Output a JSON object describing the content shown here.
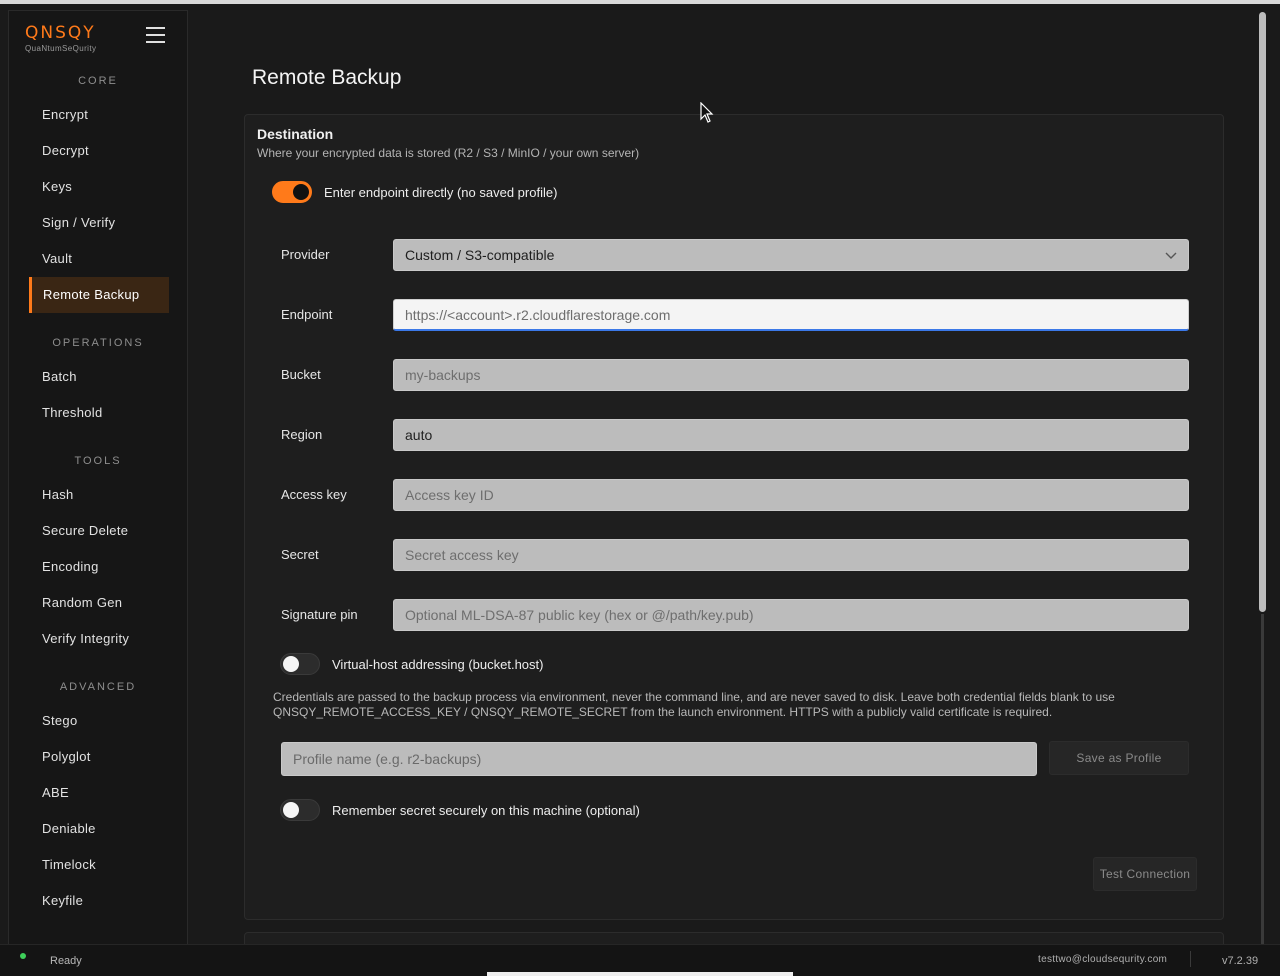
{
  "brand": {
    "logo": "QNSQY",
    "tagline": "QuaNtumSeQurity"
  },
  "sidebar": {
    "sections": [
      {
        "title": "CORE",
        "items": [
          "Encrypt",
          "Decrypt",
          "Keys",
          "Sign / Verify",
          "Vault",
          "Remote Backup"
        ]
      },
      {
        "title": "OPERATIONS",
        "items": [
          "Batch",
          "Threshold"
        ]
      },
      {
        "title": "TOOLS",
        "items": [
          "Hash",
          "Secure Delete",
          "Encoding",
          "Random Gen",
          "Verify Integrity"
        ]
      },
      {
        "title": "ADVANCED",
        "items": [
          "Stego",
          "Polyglot",
          "ABE",
          "Deniable",
          "Timelock",
          "Keyfile"
        ]
      }
    ],
    "active_item": "Remote Backup"
  },
  "page": {
    "title": "Remote Backup"
  },
  "destination": {
    "title": "Destination",
    "subtitle": "Where your encrypted data is stored (R2 / S3 / MinIO / your own server)",
    "direct_toggle": {
      "label": "Enter endpoint directly (no saved profile)",
      "on": true
    },
    "provider": {
      "label": "Provider",
      "value": "Custom / S3-compatible"
    },
    "endpoint": {
      "label": "Endpoint",
      "value": "",
      "placeholder": "https://<account>.r2.cloudflarestorage.com"
    },
    "bucket": {
      "label": "Bucket",
      "value": "",
      "placeholder": "my-backups"
    },
    "region": {
      "label": "Region",
      "value": "auto",
      "placeholder": ""
    },
    "access_key": {
      "label": "Access key",
      "value": "",
      "placeholder": "Access key ID"
    },
    "secret": {
      "label": "Secret",
      "value": "",
      "placeholder": "Secret access key"
    },
    "signature_pin": {
      "label": "Signature pin",
      "value": "",
      "placeholder": "Optional ML-DSA-87 public key (hex or @/path/key.pub)"
    },
    "virtual_host_toggle": {
      "label": "Virtual-host addressing (bucket.host)",
      "on": false
    },
    "note": "Credentials are passed to the backup process via environment, never the command line, and are never saved to disk. Leave both credential fields blank to use QNSQY_REMOTE_ACCESS_KEY / QNSQY_REMOTE_SECRET from the launch environment. HTTPS with a publicly valid certificate is required.",
    "profile_name": {
      "value": "",
      "placeholder": "Profile name (e.g. r2-backups)"
    },
    "save_profile_label": "Save as Profile",
    "remember_toggle": {
      "label": "Remember secret securely on this machine (optional)",
      "on": false
    },
    "test_connection_label": "Test Connection"
  },
  "status": {
    "text": "Ready",
    "user": "testtwo@cloudsequrity.com",
    "version": "v7.2.39"
  },
  "colors": {
    "accent": "#ff7a1a",
    "status_ok": "#3ecf5a",
    "background": "#1a1a1a"
  },
  "icons": [
    "hamburger-menu-icon",
    "chevron-down-icon",
    "mouse-cursor-icon",
    "status-dot-icon"
  ]
}
